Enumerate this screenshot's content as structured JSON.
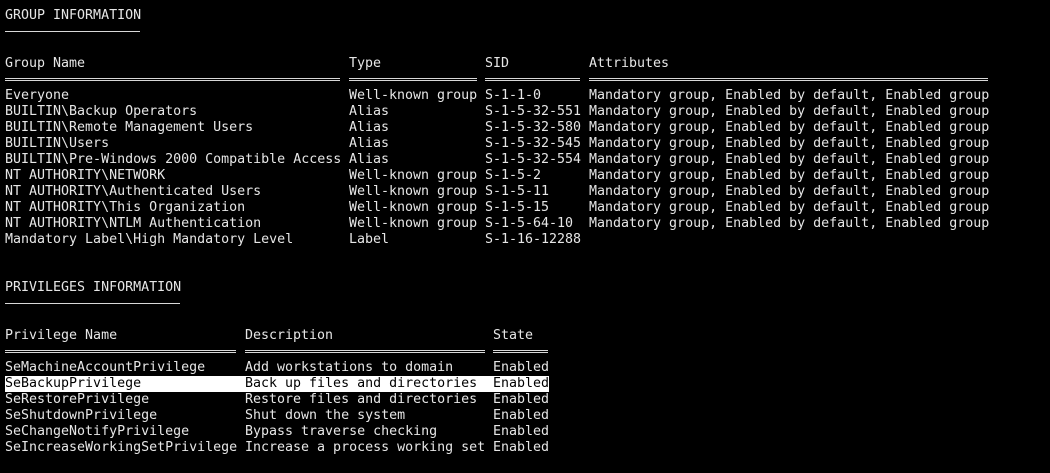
{
  "group_section": {
    "title": "GROUP INFORMATION",
    "headers": {
      "name": "Group Name",
      "type": "Type",
      "sid": "SID",
      "attributes": "Attributes"
    },
    "rows": [
      {
        "name": "Everyone",
        "type": "Well-known group",
        "sid": "S-1-1-0",
        "attributes": "Mandatory group, Enabled by default, Enabled group"
      },
      {
        "name": "BUILTIN\\Backup Operators",
        "type": "Alias",
        "sid": "S-1-5-32-551",
        "attributes": "Mandatory group, Enabled by default, Enabled group"
      },
      {
        "name": "BUILTIN\\Remote Management Users",
        "type": "Alias",
        "sid": "S-1-5-32-580",
        "attributes": "Mandatory group, Enabled by default, Enabled group"
      },
      {
        "name": "BUILTIN\\Users",
        "type": "Alias",
        "sid": "S-1-5-32-545",
        "attributes": "Mandatory group, Enabled by default, Enabled group"
      },
      {
        "name": "BUILTIN\\Pre-Windows 2000 Compatible Access",
        "type": "Alias",
        "sid": "S-1-5-32-554",
        "attributes": "Mandatory group, Enabled by default, Enabled group"
      },
      {
        "name": "NT AUTHORITY\\NETWORK",
        "type": "Well-known group",
        "sid": "S-1-5-2",
        "attributes": "Mandatory group, Enabled by default, Enabled group"
      },
      {
        "name": "NT AUTHORITY\\Authenticated Users",
        "type": "Well-known group",
        "sid": "S-1-5-11",
        "attributes": "Mandatory group, Enabled by default, Enabled group"
      },
      {
        "name": "NT AUTHORITY\\This Organization",
        "type": "Well-known group",
        "sid": "S-1-5-15",
        "attributes": "Mandatory group, Enabled by default, Enabled group"
      },
      {
        "name": "NT AUTHORITY\\NTLM Authentication",
        "type": "Well-known group",
        "sid": "S-1-5-64-10",
        "attributes": "Mandatory group, Enabled by default, Enabled group"
      },
      {
        "name": "Mandatory Label\\High Mandatory Level",
        "type": "Label",
        "sid": "S-1-16-12288",
        "attributes": ""
      }
    ]
  },
  "privileges_section": {
    "title": "PRIVILEGES INFORMATION",
    "headers": {
      "name": "Privilege Name",
      "description": "Description",
      "state": "State"
    },
    "rows": [
      {
        "name": "SeMachineAccountPrivilege",
        "description": "Add workstations to domain",
        "state": "Enabled"
      },
      {
        "name": "SeBackupPrivilege",
        "description": "Back up files and directories",
        "state": "Enabled"
      },
      {
        "name": "SeRestorePrivilege",
        "description": "Restore files and directories",
        "state": "Enabled"
      },
      {
        "name": "SeShutdownPrivilege",
        "description": "Shut down the system",
        "state": "Enabled"
      },
      {
        "name": "SeChangeNotifyPrivilege",
        "description": "Bypass traverse checking",
        "state": "Enabled"
      },
      {
        "name": "SeIncreaseWorkingSetPrivilege",
        "description": "Increase a process working set",
        "state": "Enabled"
      }
    ],
    "highlighted_row": 1
  },
  "colors": {
    "background": "#000000",
    "text": "#e6e6e6",
    "selection_background": "#ffffff",
    "selection_text": "#000000"
  }
}
